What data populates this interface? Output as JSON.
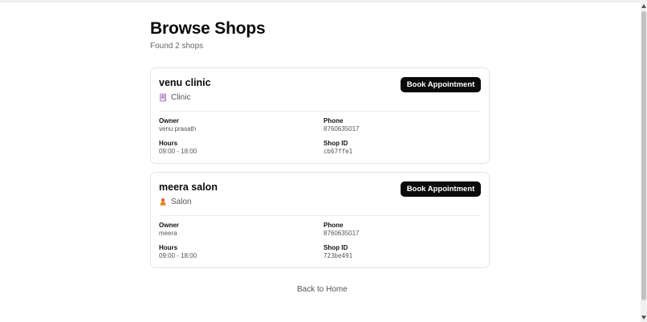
{
  "page": {
    "title": "Browse Shops",
    "subtitle": "Found 2 shops",
    "back_link": "Back to Home"
  },
  "labels": {
    "owner": "Owner",
    "phone": "Phone",
    "hours": "Hours",
    "shop_id": "Shop ID",
    "book": "Book Appointment"
  },
  "shops": [
    {
      "name": "venu clinic",
      "type": "Clinic",
      "type_icon": "clinic-icon",
      "owner": "venu prasath",
      "phone": "8760635017",
      "hours": "09:00 - 18:00",
      "shop_id": "cb67ffe1"
    },
    {
      "name": "meera salon",
      "type": "Salon",
      "type_icon": "salon-icon",
      "owner": "meera",
      "phone": "8760635017",
      "hours": "09:00 - 18:00",
      "shop_id": "723be491"
    }
  ]
}
